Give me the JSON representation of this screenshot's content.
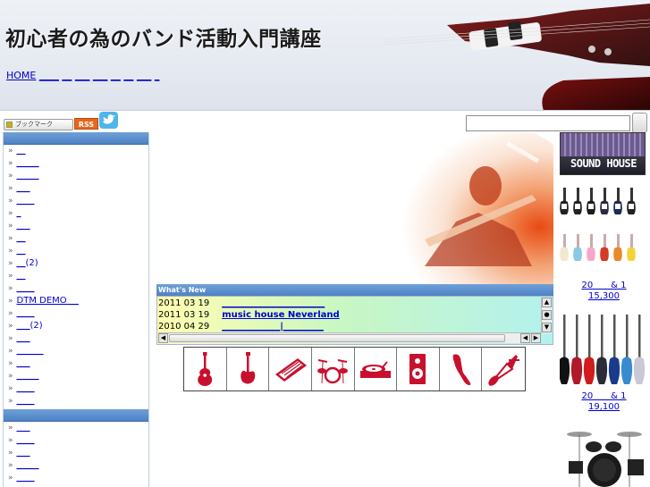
{
  "header": {
    "title": "初心者の為のバンド活動入門講座",
    "nav_home": "HOME",
    "nav_blanks": [
      "____",
      "__",
      "___",
      "___",
      "__",
      "__",
      "___",
      "_"
    ]
  },
  "toolbar": {
    "bookmark_label": "ブックマーク",
    "rss_label": "RSS",
    "search_placeholder": ""
  },
  "sidebar": {
    "group1": [
      {
        "label": "__"
      },
      {
        "label": "_____"
      },
      {
        "label": "_____"
      },
      {
        "label": "___"
      },
      {
        "label": "____"
      },
      {
        "label": "_"
      },
      {
        "label": "___"
      },
      {
        "label": "__"
      },
      {
        "label": "__"
      },
      {
        "label": "__",
        "count": "(2)"
      },
      {
        "label": "__"
      },
      {
        "label": "____"
      },
      {
        "label": "DTM DEMO __"
      },
      {
        "label": "____"
      },
      {
        "label": "___",
        "count": "(2)"
      },
      {
        "label": "___"
      },
      {
        "label": "______"
      },
      {
        "label": "___"
      },
      {
        "label": "_____"
      },
      {
        "label": "____"
      },
      {
        "label": "____"
      }
    ],
    "group2": [
      {
        "label": "___"
      },
      {
        "label": "____"
      },
      {
        "label": "___"
      },
      {
        "label": "_____"
      },
      {
        "label": "____"
      }
    ]
  },
  "news": {
    "heading": "What's New",
    "rows": [
      {
        "date": "2011 03 19",
        "title": "_______________________"
      },
      {
        "date": "2011 03 19",
        "title": "music house Neverland"
      },
      {
        "date": "2010 04 29",
        "title": "_____________|_________"
      }
    ]
  },
  "categories": [
    {
      "icon": "acoustic-guitar-icon"
    },
    {
      "icon": "electric-guitar-icon"
    },
    {
      "icon": "keyboard-icon"
    },
    {
      "icon": "drum-kit-icon"
    },
    {
      "icon": "turntable-icon"
    },
    {
      "icon": "speaker-icon"
    },
    {
      "icon": "microphone-icon"
    },
    {
      "icon": "stage-light-icon"
    }
  ],
  "ads": {
    "banner_text": "SOUND HOUSE",
    "product1": {
      "line1": "20　　& 1",
      "price": "15,300"
    },
    "product2": {
      "line1": "20　　& 1",
      "price": "19,100"
    }
  },
  "colors": {
    "accent_blue": "#4d82c4",
    "link": "#0000cc",
    "icon_red": "#c8102e"
  }
}
